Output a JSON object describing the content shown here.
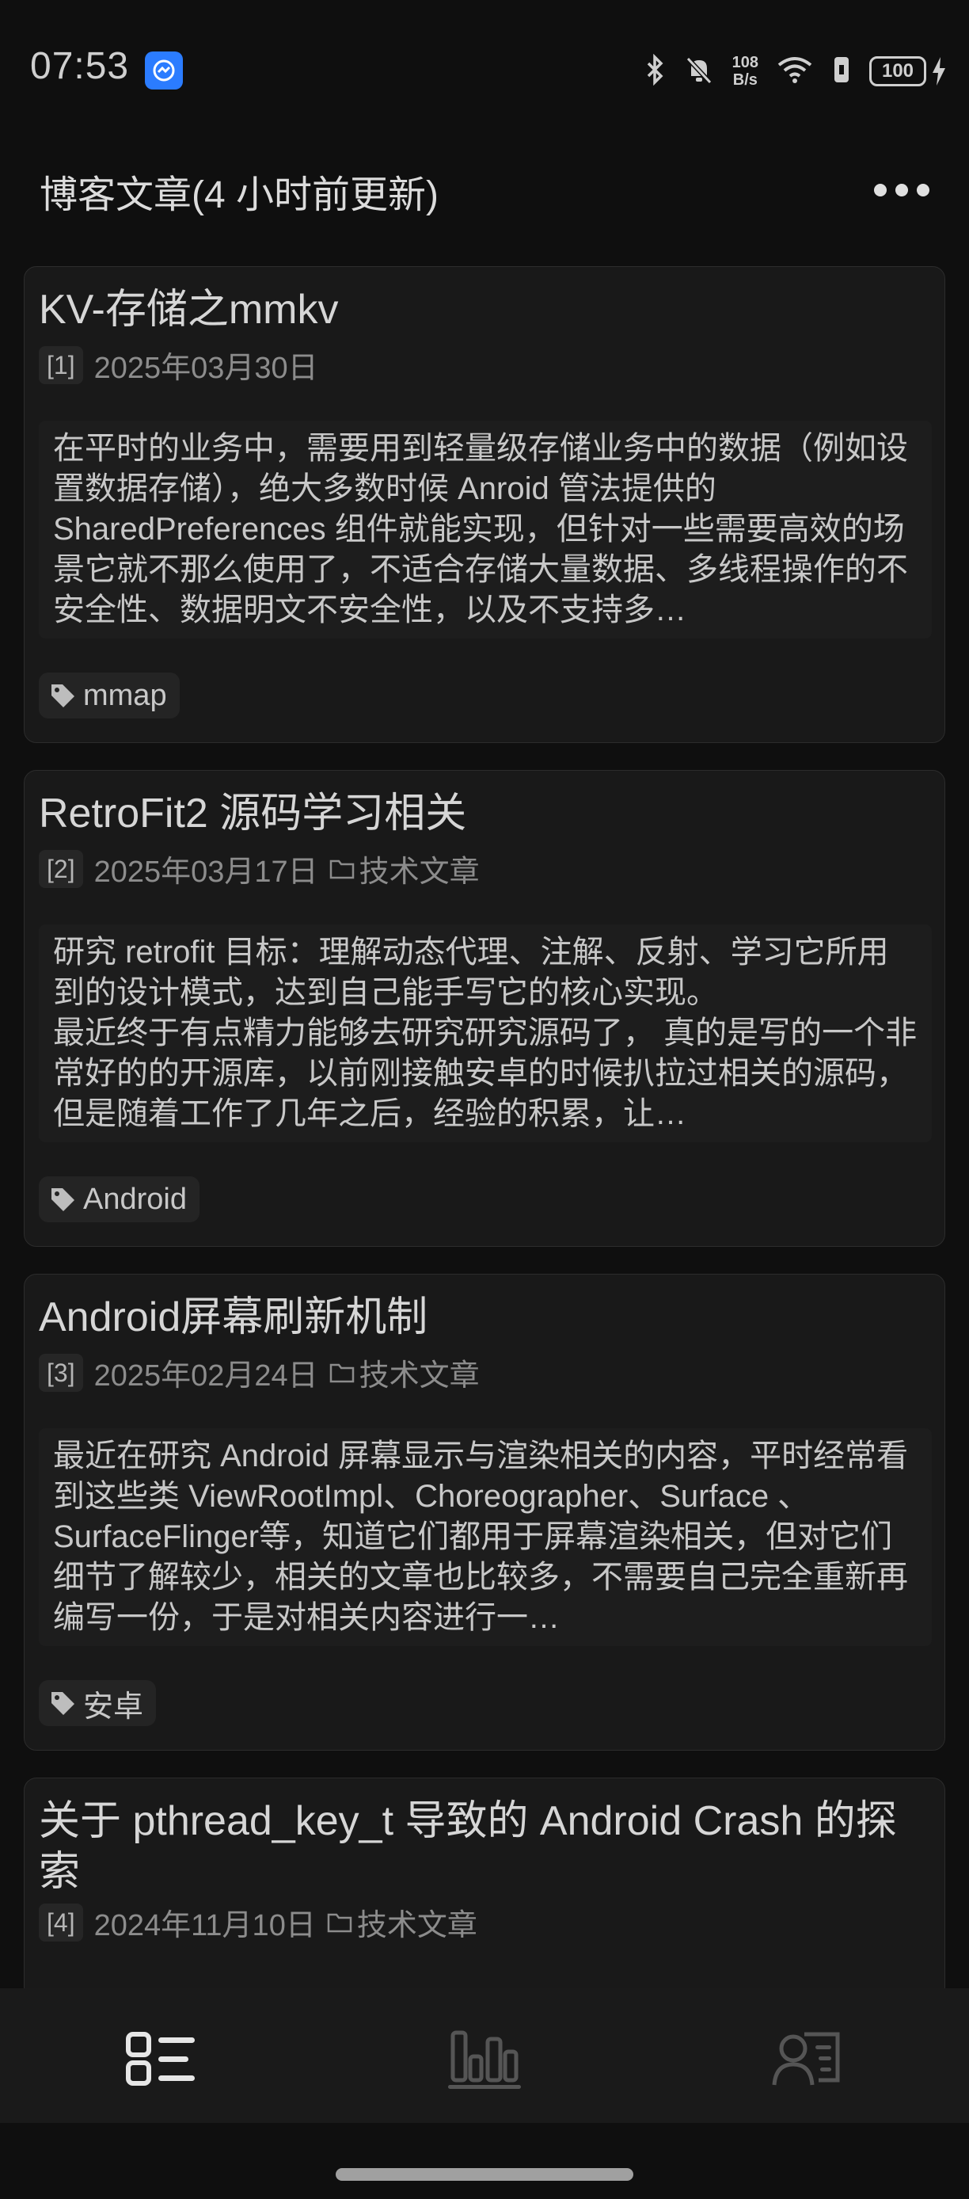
{
  "status_bar": {
    "time": "07:53",
    "network_speed_value": "108",
    "network_speed_unit": "B/s",
    "battery": "100"
  },
  "header": {
    "title": "博客文章(4 小时前更新)"
  },
  "posts": [
    {
      "title": "KV-存储之mmkv",
      "index": "[1]",
      "date": "2025年03月30日",
      "category": "",
      "summary": "在平时的业务中，需要用到轻量级存储业务中的数据（例如设置数据存储），绝大多数时候 Anroid 管法提供的 SharedPreferences  组件就能实现，但针对一些需要高效的场景它就不那么使用了，不适合存储大量数据、多线程操作的不安全性、数据明文不安全性，以及不支持多…",
      "tag": "mmap"
    },
    {
      "title": "RetroFit2 源码学习相关",
      "index": "[2]",
      "date": "2025年03月17日",
      "category": "技术文章",
      "summary": "研究 retrofit 目标：理解动态代理、注解、反射、学习它所用到的设计模式，达到自己能手写它的核心实现。\n最近终于有点精力能够去研究研究源码了， 真的是写的一个非常好的的开源库，以前刚接触安卓的时候扒拉过相关的源码，但是随着工作了几年之后，经验的积累，让…",
      "tag": "Android"
    },
    {
      "title": "Android屏幕刷新机制",
      "index": "[3]",
      "date": "2025年02月24日",
      "category": "技术文章",
      "summary": "最近在研究 Android 屏幕显示与渲染相关的内容，平时经常看到这些类 ViewRootImpl、Choreographer、Surface 、 SurfaceFlinger等，知道它们都用于屏幕渲染相关，但对它们细节了解较少，相关的文章也比较多，不需要自己完全重新再编写一份，于是对相关内容进行一…",
      "tag": "安卓"
    },
    {
      "title": "关于 pthread_key_t 导致的 Android Crash 的探索",
      "index": "[4]",
      "date": "2024年11月10日",
      "category": "技术文章",
      "summary": "",
      "tag": ""
    }
  ],
  "bottom_nav": {
    "items": [
      {
        "icon": "list-icon",
        "active": true
      },
      {
        "icon": "bar-chart-icon",
        "active": false
      },
      {
        "icon": "profile-icon",
        "active": false
      }
    ]
  },
  "colors": {
    "background": "#0f0f0f",
    "card": "#191919",
    "nav_active": "#e6e6e6",
    "nav_inactive": "#555555",
    "accent_app_icon": "#2b7cff"
  }
}
